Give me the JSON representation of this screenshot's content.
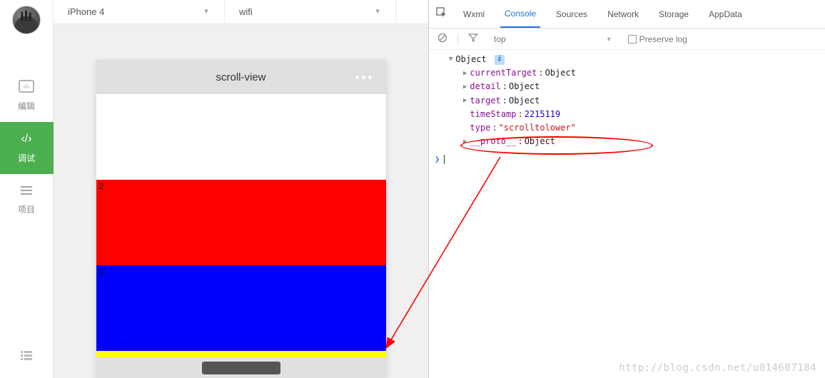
{
  "sidebar": {
    "items": [
      {
        "label": "编辑",
        "icon": "code-box-icon"
      },
      {
        "label": "调试",
        "icon": "code-icon"
      },
      {
        "label": "项目",
        "icon": "menu-icon"
      }
    ]
  },
  "topbar": {
    "device": "iPhone 4",
    "network": "wifi"
  },
  "simulator": {
    "title": "scroll-view",
    "blocks": [
      {
        "num": "",
        "cls": "white"
      },
      {
        "num": "2",
        "cls": "red"
      },
      {
        "num": "3",
        "cls": "blue"
      },
      {
        "num": "",
        "cls": "yellow"
      }
    ]
  },
  "devtools": {
    "tabs": [
      "Wxml",
      "Console",
      "Sources",
      "Network",
      "Storage",
      "AppData"
    ],
    "active_tab": "Console",
    "context": "top",
    "preserve_log_label": "Preserve log",
    "object": {
      "header": "Object",
      "props": [
        {
          "key": "currentTarget",
          "val": "Object",
          "type": "obj",
          "tri": true
        },
        {
          "key": "detail",
          "val": "Object",
          "type": "obj",
          "tri": true
        },
        {
          "key": "target",
          "val": "Object",
          "type": "obj",
          "tri": true
        },
        {
          "key": "timeStamp",
          "val": "2215119",
          "type": "num",
          "tri": false
        },
        {
          "key": "type",
          "val": "\"scrolltolower\"",
          "type": "str",
          "tri": false
        },
        {
          "key": "__proto__",
          "val": "Object",
          "type": "obj",
          "tri": true
        }
      ]
    }
  },
  "watermark": "http://blog.csdn.net/u014607184"
}
